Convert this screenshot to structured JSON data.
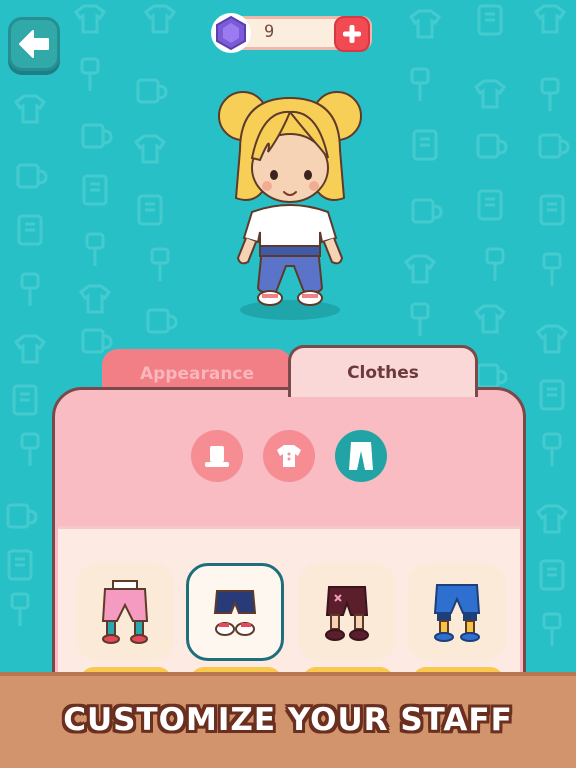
{
  "header": {
    "back_icon": "arrow-left-icon",
    "gem_count": "9",
    "plus_icon": "plus-icon"
  },
  "tabs": [
    {
      "label": "Appearance",
      "active": false
    },
    {
      "label": "Clothes",
      "active": true
    }
  ],
  "categories": [
    {
      "icon": "hat-icon",
      "active": false
    },
    {
      "icon": "shirt-icon",
      "active": false
    },
    {
      "icon": "pants-icon",
      "active": true
    }
  ],
  "items": [
    {
      "icon": "pink-pants-icon",
      "selected": false
    },
    {
      "icon": "navy-shorts-icon",
      "selected": true
    },
    {
      "icon": "maroon-shorts-icon",
      "selected": false
    },
    {
      "icon": "blue-pants-icon",
      "selected": false
    }
  ],
  "banner": {
    "text": "CUSTOMIZE YOUR STAFF"
  },
  "colors": {
    "background": "#27c0c6",
    "panel": "#f9bcc3",
    "accent": "#22a3a6",
    "banner": "#d1946c",
    "plus_button": "#f14a52",
    "gem": "#7b5bd6"
  }
}
